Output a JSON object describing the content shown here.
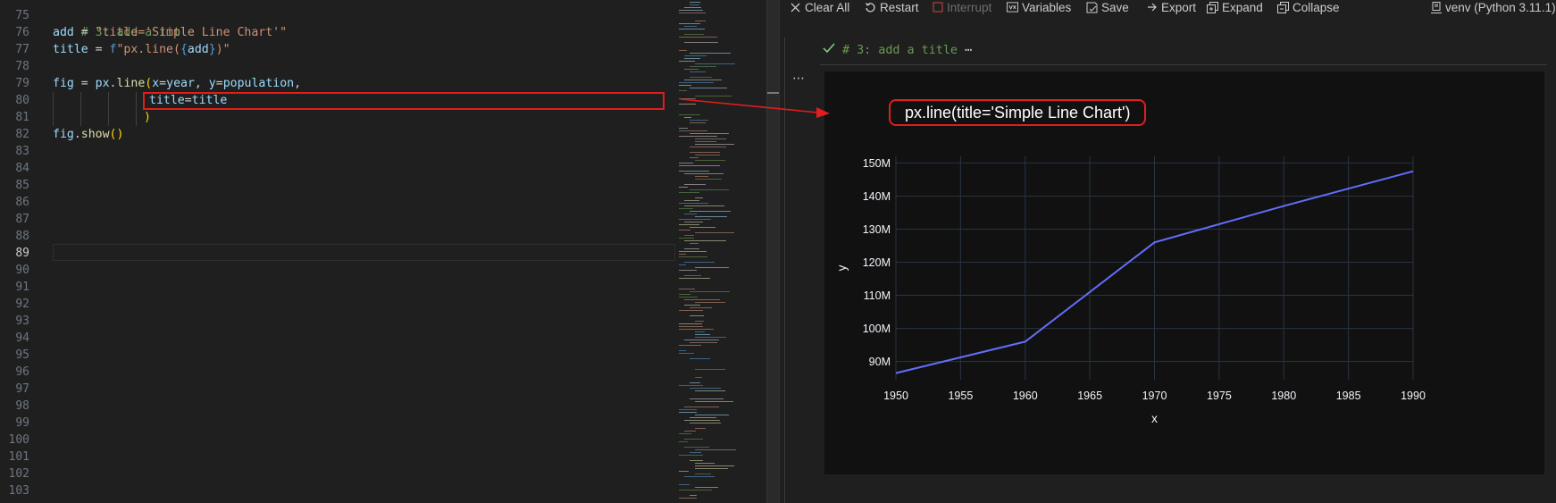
{
  "editor": {
    "line_numbers": [
      "75",
      "76",
      "77",
      "78",
      "79",
      "80",
      "81",
      "82",
      "83",
      "84",
      "85",
      "86",
      "87",
      "88",
      "89",
      "90",
      "91",
      "92",
      "93",
      "94",
      "95",
      "96",
      "97",
      "98",
      "99",
      "100",
      "101",
      "102",
      "103"
    ],
    "active_line": "89",
    "code": {
      "l75_comment": "# 3: add a title",
      "l76_var": "add",
      "l76_eq": " = ",
      "l76_str": "\"title='Simple Line Chart'\"",
      "l77_var": "title",
      "l77_eq": " = ",
      "l77_f": "f",
      "l77_str_a": "\"px.line(",
      "l77_brace_open": "{",
      "l77_add": "add",
      "l77_brace_close": "}",
      "l77_str_b": ")\"",
      "l79_fig": "fig",
      "l79_eq": " = ",
      "l79_px": "px",
      "l79_dot": ".",
      "l79_line": "line",
      "l79_paren": "(",
      "l79_x": "x",
      "l79_eq2": "=",
      "l79_year": "year",
      "l79_comma": ", ",
      "l79_y": "y",
      "l79_eq3": "=",
      "l79_population": "population",
      "l79_comma2": ",",
      "l80_title": "title",
      "l80_eq": "=",
      "l80_title2": "title",
      "l81_paren": ")",
      "l82_fig": "fig",
      "l82_dot": ".",
      "l82_show": "show",
      "l82_parens": "()"
    }
  },
  "toolbar": {
    "clear_all": "Clear All",
    "restart": "Restart",
    "interrupt": "Interrupt",
    "variables": "Variables",
    "save": "Save",
    "export": "Export",
    "expand": "Expand",
    "collapse": "Collapse",
    "kernel": "venv (Python 3.11.1)"
  },
  "cell": {
    "header_text": "# 3: add a title",
    "ellipsis": "⋯",
    "more_actions": "⋯",
    "callout_text": "px.line(title='Simple Line Chart')"
  },
  "colors": {
    "line": "#636efa",
    "grid": "#283442",
    "annotation": "#e01e1e",
    "plot_bg": "#111111"
  },
  "chart_data": {
    "type": "line",
    "title": "",
    "xlabel": "x",
    "ylabel": "y",
    "x": [
      1950,
      1960,
      1970,
      1980,
      1990
    ],
    "series": [
      {
        "values": [
          86.5,
          96,
          126,
          137,
          147.5
        ]
      }
    ],
    "y_unit": "M",
    "xlim": [
      1950,
      1990
    ],
    "ylim": [
      84.5,
      152
    ],
    "x_ticks": [
      "1950",
      "1955",
      "1960",
      "1965",
      "1970",
      "1975",
      "1980",
      "1985",
      "1990"
    ],
    "y_ticks": [
      "90M",
      "100M",
      "110M",
      "120M",
      "130M",
      "140M",
      "150M"
    ],
    "grid": true
  }
}
